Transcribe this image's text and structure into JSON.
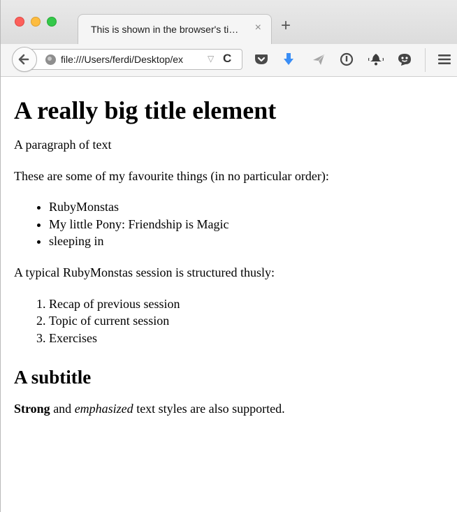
{
  "browser": {
    "tab_title": "This is shown in the browser's ti…",
    "tab_close_glyph": "×",
    "new_tab_glyph": "+",
    "url": "file:///Users/ferdi/Desktop/ex",
    "url_dropdown_glyph": "▽",
    "reload_glyph": "C",
    "toolbar_icons": [
      "pocket-icon",
      "download-icon",
      "send-icon",
      "password-icon",
      "notification-icon",
      "emoji-icon",
      "hamburger-menu-icon"
    ],
    "colors": {
      "close": "#fc605b",
      "minimize": "#fdbc40",
      "maximize": "#34c84a",
      "download": "#3a8ef6"
    }
  },
  "page": {
    "heading": "A really big title element",
    "paragraph1": "A paragraph of text",
    "paragraph2": "These are some of my favourite things (in no particular order):",
    "favourites": [
      "RubyMonstas",
      "My little Pony: Friendship is Magic",
      "sleeping in"
    ],
    "paragraph3": "A typical RubyMonstas session is structured thusly:",
    "session_steps": [
      "Recap of previous session",
      "Topic of current session",
      "Exercises"
    ],
    "subtitle": "A subtitle",
    "strong_text": "Strong",
    "and_text": " and ",
    "emphasized_text": "emphasized",
    "styles_text": " text styles are also supported."
  }
}
